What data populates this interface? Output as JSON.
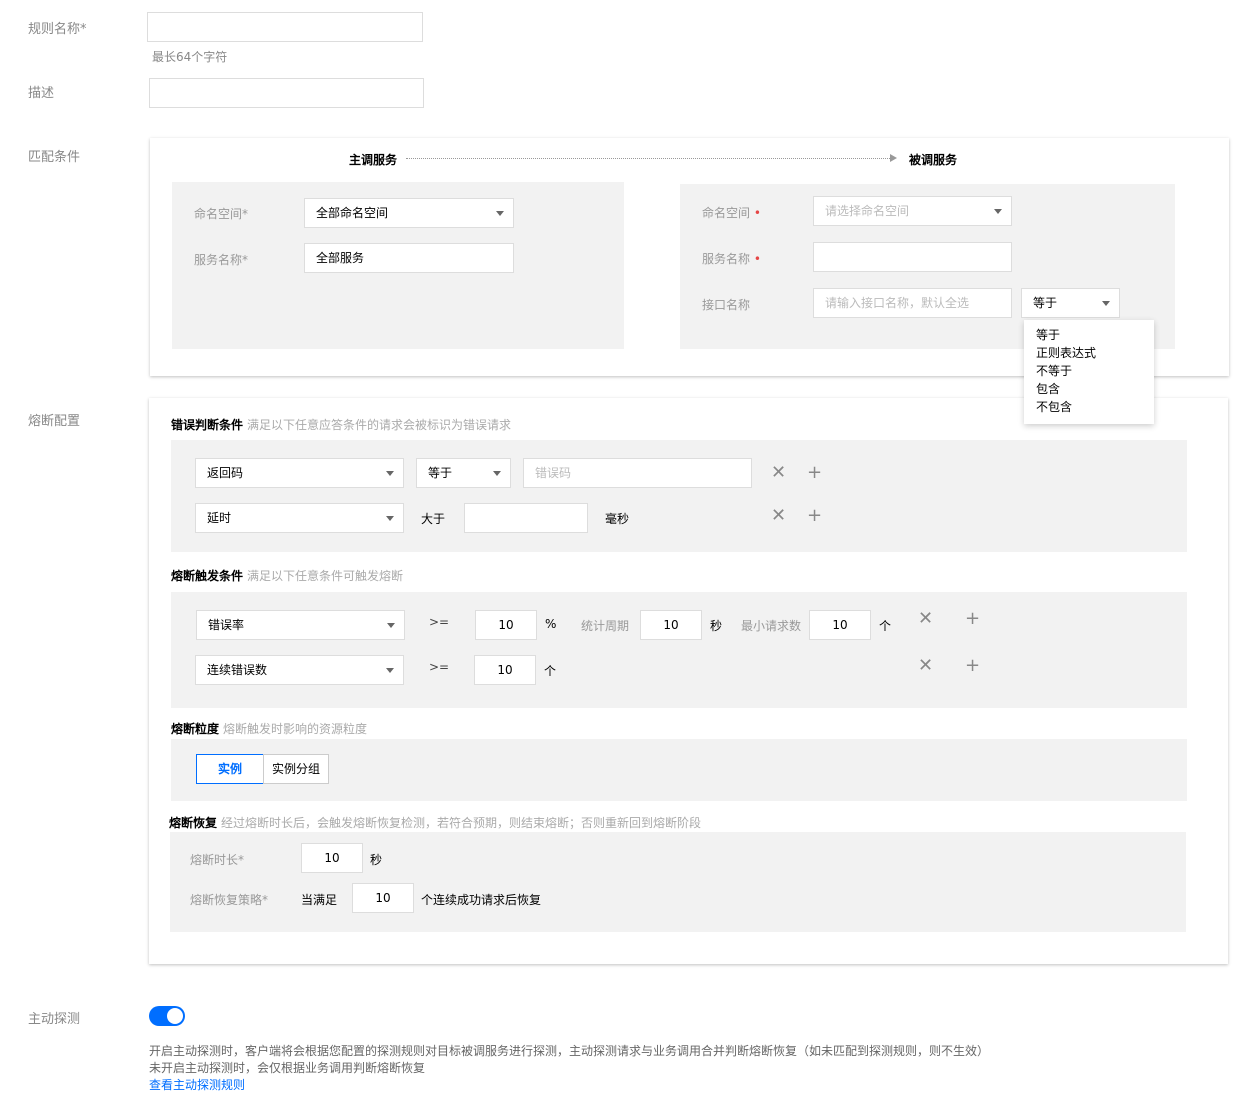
{
  "rule_name": {
    "label": "规则名称*",
    "value": "",
    "hint": "最长64个字符"
  },
  "description": {
    "label": "描述",
    "value": ""
  },
  "match": {
    "label": "匹配条件",
    "caller_title": "主调服务",
    "callee_title": "被调服务",
    "caller": {
      "namespace_label": "命名空间*",
      "namespace_value": "全部命名空间",
      "service_label": "服务名称*",
      "service_value": "全部服务"
    },
    "callee": {
      "namespace_label": "命名空间",
      "namespace_placeholder": "请选择命名空间",
      "service_label": "服务名称",
      "service_value": "",
      "interface_label": "接口名称",
      "interface_placeholder": "请输入接口名称，默认全选",
      "operator_value": "等于",
      "operator_options": [
        "等于",
        "正则表达式",
        "不等于",
        "包含",
        "不包含"
      ]
    }
  },
  "breaker": {
    "label": "熔断配置",
    "error_cond": {
      "title": "错误判断条件",
      "hint": "满足以下任意应答条件的请求会被标识为错误请求",
      "row1": {
        "field": "返回码",
        "operator": "等于",
        "placeholder": "错误码"
      },
      "row2": {
        "field": "延时",
        "operator": "大于",
        "value": "",
        "unit": "毫秒"
      }
    },
    "trigger": {
      "title": "熔断触发条件",
      "hint": "满足以下任意条件可触发熔断",
      "row1": {
        "field": "错误率",
        "op": ">=",
        "value": "10",
        "unit": "%",
        "period_label": "统计周期",
        "period_value": "10",
        "period_unit": "秒",
        "min_label": "最小请求数",
        "min_value": "10",
        "min_unit": "个"
      },
      "row2": {
        "field": "连续错误数",
        "op": ">=",
        "value": "10",
        "unit": "个"
      }
    },
    "granularity": {
      "title": "熔断粒度",
      "hint": "熔断触发时影响的资源粒度",
      "options": [
        "实例",
        "实例分组"
      ],
      "selected": "实例"
    },
    "recovery": {
      "title": "熔断恢复",
      "hint": "经过熔断时长后，会触发熔断恢复检测，若符合预期，则结束熔断；否则重新回到熔断阶段",
      "duration_label": "熔断时长*",
      "duration_value": "10",
      "duration_unit": "秒",
      "strategy_label": "熔断恢复策略*",
      "strategy_prefix": "当满足",
      "strategy_value": "10",
      "strategy_suffix": "个连续成功请求后恢复"
    }
  },
  "active_probe": {
    "label": "主动探测",
    "enabled": true,
    "line1": "开启主动探测时，客户端将会根据您配置的探测规则对目标被调服务进行探测，主动探测请求与业务调用合并判断熔断恢复（如未匹配到探测规则，则不生效）",
    "line2": "未开启主动探测时，会仅根据业务调用判断熔断恢复",
    "link": "查看主动探测规则"
  },
  "colors": {
    "accent": "#006eff",
    "required": "#e54545",
    "panel": "#f2f2f2"
  }
}
